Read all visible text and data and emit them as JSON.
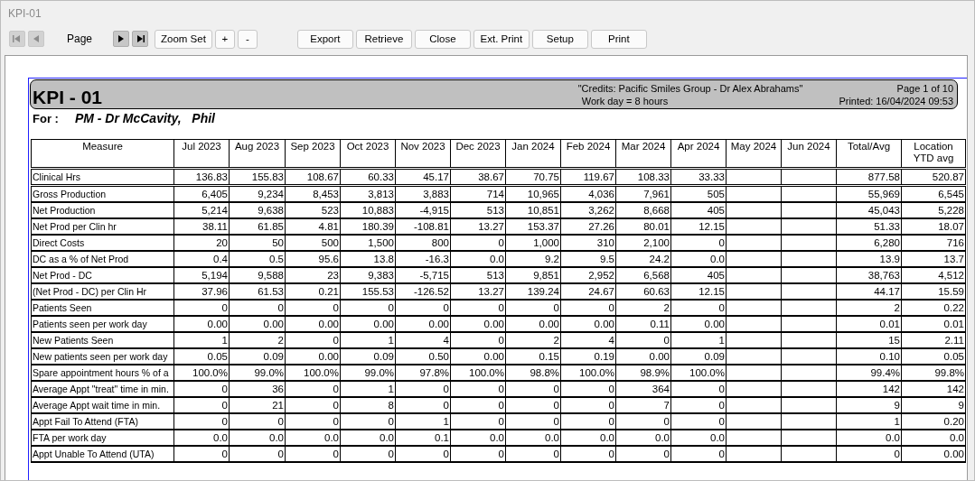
{
  "window": {
    "title": "KPI-01"
  },
  "toolbar": {
    "nav": [
      {
        "kind": "first",
        "disabled": true
      },
      {
        "kind": "prev",
        "disabled": true
      }
    ],
    "page_label": "Page",
    "nav_after": [
      {
        "kind": "next",
        "disabled": false
      },
      {
        "kind": "last",
        "disabled": false
      }
    ],
    "zoom": [
      "Zoom Set",
      "+",
      "-"
    ],
    "actions": [
      "Export",
      "Retrieve",
      "Close",
      "Ext. Print",
      "Setup",
      "Print"
    ]
  },
  "report": {
    "title": "KPI - 01",
    "credits": "\"Credits: Pacific Smiles Group - Dr Alex Abrahams\"",
    "workday": "Work day = 8 hours",
    "page": "Page 1 of 10",
    "printed": "Printed: 16/04/2024 09:53",
    "for_label": "For :",
    "for_value": "PM - Dr McCavity,   Phil"
  },
  "table": {
    "columns": [
      "Measure",
      "Jul 2023",
      "Aug 2023",
      "Sep 2023",
      "Oct 2023",
      "Nov 2023",
      "Dec 2023",
      "Jan 2024",
      "Feb 2024",
      "Mar 2024",
      "Apr 2024",
      "May 2024",
      "Jun 2024",
      "Total/Avg",
      "Location YTD avg"
    ],
    "rows": [
      [
        "Clinical Hrs",
        "136.83",
        "155.83",
        "108.67",
        "60.33",
        "45.17",
        "38.67",
        "70.75",
        "119.67",
        "108.33",
        "33.33",
        "",
        "",
        "877.58",
        "520.87"
      ],
      [
        "Gross Production",
        "6,405",
        "9,234",
        "8,453",
        "3,813",
        "3,883",
        "714",
        "10,965",
        "4,036",
        "7,961",
        "505",
        "",
        "",
        "55,969",
        "6,545"
      ],
      [
        "Net Production",
        "5,214",
        "9,638",
        "523",
        "10,883",
        "-4,915",
        "513",
        "10,851",
        "3,262",
        "8,668",
        "405",
        "",
        "",
        "45,043",
        "5,228"
      ],
      [
        "Net Prod per Clin hr",
        "38.11",
        "61.85",
        "4.81",
        "180.39",
        "-108.81",
        "13.27",
        "153.37",
        "27.26",
        "80.01",
        "12.15",
        "",
        "",
        "51.33",
        "18.07"
      ],
      [
        "Direct Costs",
        "20",
        "50",
        "500",
        "1,500",
        "800",
        "0",
        "1,000",
        "310",
        "2,100",
        "0",
        "",
        "",
        "6,280",
        "716"
      ],
      [
        "DC as a % of Net Prod",
        "0.4",
        "0.5",
        "95.6",
        "13.8",
        "-16.3",
        "0.0",
        "9.2",
        "9.5",
        "24.2",
        "0.0",
        "",
        "",
        "13.9",
        "13.7"
      ],
      [
        "Net Prod - DC",
        "5,194",
        "9,588",
        "23",
        "9,383",
        "-5,715",
        "513",
        "9,851",
        "2,952",
        "6,568",
        "405",
        "",
        "",
        "38,763",
        "4,512"
      ],
      [
        "(Net Prod - DC) per Clin Hr",
        "37.96",
        "61.53",
        "0.21",
        "155.53",
        "-126.52",
        "13.27",
        "139.24",
        "24.67",
        "60.63",
        "12.15",
        "",
        "",
        "44.17",
        "15.59"
      ],
      [
        "Patients Seen",
        "0",
        "0",
        "0",
        "0",
        "0",
        "0",
        "0",
        "0",
        "2",
        "0",
        "",
        "",
        "2",
        "0.22"
      ],
      [
        "Patients seen per work day",
        "0.00",
        "0.00",
        "0.00",
        "0.00",
        "0.00",
        "0.00",
        "0.00",
        "0.00",
        "0.11",
        "0.00",
        "",
        "",
        "0.01",
        "0.01"
      ],
      [
        "New Patients Seen",
        "1",
        "2",
        "0",
        "1",
        "4",
        "0",
        "2",
        "4",
        "0",
        "1",
        "",
        "",
        "15",
        "2.11"
      ],
      [
        "New patients seen per work day",
        "0.05",
        "0.09",
        "0.00",
        "0.09",
        "0.50",
        "0.00",
        "0.15",
        "0.19",
        "0.00",
        "0.09",
        "",
        "",
        "0.10",
        "0.05"
      ],
      [
        "Spare appointment hours % of a",
        "100.0%",
        "99.0%",
        "100.0%",
        "99.0%",
        "97.8%",
        "100.0%",
        "98.8%",
        "100.0%",
        "98.9%",
        "100.0%",
        "",
        "",
        "99.4%",
        "99.8%"
      ],
      [
        "Average Appt \"treat\" time in min.",
        "0",
        "36",
        "0",
        "1",
        "0",
        "0",
        "0",
        "0",
        "364",
        "0",
        "",
        "",
        "142",
        "142"
      ],
      [
        "Average Appt wait time in min.",
        "0",
        "21",
        "0",
        "8",
        "0",
        "0",
        "0",
        "0",
        "7",
        "0",
        "",
        "",
        "9",
        "9"
      ],
      [
        "Appt Fail To Attend (FTA)",
        "0",
        "0",
        "0",
        "0",
        "1",
        "0",
        "0",
        "0",
        "0",
        "0",
        "",
        "",
        "1",
        "0.20"
      ],
      [
        "FTA per work day",
        "0.0",
        "0.0",
        "0.0",
        "0.0",
        "0.1",
        "0.0",
        "0.0",
        "0.0",
        "0.0",
        "0.0",
        "",
        "",
        "0.0",
        "0.0"
      ],
      [
        "Appt Unable To Attend (UTA)",
        "0",
        "0",
        "0",
        "0",
        "0",
        "0",
        "0",
        "0",
        "0",
        "0",
        "",
        "",
        "0",
        "0.00"
      ]
    ]
  }
}
